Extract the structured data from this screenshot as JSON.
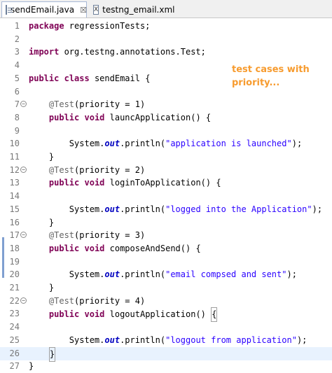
{
  "tabs": [
    {
      "label": "sendEmail.java",
      "icon": "java-file-icon",
      "active": true,
      "close": "☒"
    },
    {
      "label": "testng_email.xml",
      "icon": "xml-file-icon",
      "active": false,
      "icon_text": "X"
    }
  ],
  "note": "test cases with priority...",
  "colors": {
    "keyword": "#7f0055",
    "string": "#2a00ff",
    "annotation": "#646464",
    "note": "#f79b2e"
  },
  "lines": [
    {
      "n": "1",
      "fold": "",
      "tokens": [
        [
          "kw",
          "package"
        ],
        [
          "p",
          " regressionTests;"
        ]
      ]
    },
    {
      "n": "2",
      "fold": "",
      "tokens": []
    },
    {
      "n": "3",
      "fold": "",
      "tokens": [
        [
          "kw",
          "import"
        ],
        [
          "p",
          " org.testng.annotations.Test;"
        ]
      ]
    },
    {
      "n": "4",
      "fold": "",
      "tokens": []
    },
    {
      "n": "5",
      "fold": "",
      "tokens": [
        [
          "kw",
          "public"
        ],
        [
          "p",
          " "
        ],
        [
          "kw",
          "class"
        ],
        [
          "p",
          " sendEmail {"
        ]
      ]
    },
    {
      "n": "6",
      "fold": "",
      "tokens": []
    },
    {
      "n": "7",
      "fold": "⊖",
      "tokens": [
        [
          "p",
          "    "
        ],
        [
          "ann",
          "@Test"
        ],
        [
          "p",
          "(priority = 1)"
        ]
      ]
    },
    {
      "n": "8",
      "fold": "",
      "tokens": [
        [
          "p",
          "    "
        ],
        [
          "kw",
          "public"
        ],
        [
          "p",
          " "
        ],
        [
          "kw",
          "void"
        ],
        [
          "p",
          " launcApplication() {"
        ]
      ]
    },
    {
      "n": "9",
      "fold": "",
      "tokens": []
    },
    {
      "n": "10",
      "fold": "",
      "tokens": [
        [
          "p",
          "        System."
        ],
        [
          "stat",
          "out"
        ],
        [
          "p",
          ".println("
        ],
        [
          "str",
          "\"application is launched\""
        ],
        [
          "p",
          ");"
        ]
      ]
    },
    {
      "n": "11",
      "fold": "",
      "tokens": [
        [
          "p",
          "    }"
        ]
      ]
    },
    {
      "n": "12",
      "fold": "⊖",
      "tokens": [
        [
          "p",
          "    "
        ],
        [
          "ann",
          "@Test"
        ],
        [
          "p",
          "(priority = 2)"
        ]
      ]
    },
    {
      "n": "13",
      "fold": "",
      "tokens": [
        [
          "p",
          "    "
        ],
        [
          "kw",
          "public"
        ],
        [
          "p",
          " "
        ],
        [
          "kw",
          "void"
        ],
        [
          "p",
          " loginToApplication() {"
        ]
      ]
    },
    {
      "n": "14",
      "fold": "",
      "tokens": []
    },
    {
      "n": "15",
      "fold": "",
      "tokens": [
        [
          "p",
          "        System."
        ],
        [
          "stat",
          "out"
        ],
        [
          "p",
          ".println("
        ],
        [
          "str",
          "\"logged into the Application\""
        ],
        [
          "p",
          ");"
        ]
      ]
    },
    {
      "n": "16",
      "fold": "",
      "tokens": [
        [
          "p",
          "    }"
        ]
      ]
    },
    {
      "n": "17",
      "fold": "⊖",
      "tokens": [
        [
          "p",
          "    "
        ],
        [
          "ann",
          "@Test"
        ],
        [
          "p",
          "(priority = 3)"
        ]
      ]
    },
    {
      "n": "18",
      "fold": "",
      "tokens": [
        [
          "p",
          "    "
        ],
        [
          "kw",
          "public"
        ],
        [
          "p",
          " "
        ],
        [
          "kw",
          "void"
        ],
        [
          "p",
          " composeAndSend() {"
        ]
      ]
    },
    {
      "n": "19",
      "fold": "",
      "tokens": []
    },
    {
      "n": "20",
      "fold": "",
      "tokens": [
        [
          "p",
          "        System."
        ],
        [
          "stat",
          "out"
        ],
        [
          "p",
          ".println("
        ],
        [
          "str",
          "\"email compsed and sent\""
        ],
        [
          "p",
          ");"
        ]
      ]
    },
    {
      "n": "21",
      "fold": "",
      "tokens": [
        [
          "p",
          "    }"
        ]
      ]
    },
    {
      "n": "22",
      "fold": "⊖",
      "tokens": [
        [
          "p",
          "    "
        ],
        [
          "ann",
          "@Test"
        ],
        [
          "p",
          "(priority = 4)"
        ]
      ]
    },
    {
      "n": "23",
      "fold": "",
      "tokens": [
        [
          "p",
          "    "
        ],
        [
          "kw",
          "public"
        ],
        [
          "p",
          " "
        ],
        [
          "kw",
          "void"
        ],
        [
          "p",
          " logoutApplication() "
        ],
        [
          "box",
          "{"
        ]
      ]
    },
    {
      "n": "24",
      "fold": "",
      "tokens": []
    },
    {
      "n": "25",
      "fold": "",
      "tokens": [
        [
          "p",
          "        System."
        ],
        [
          "stat",
          "out"
        ],
        [
          "p",
          ".println("
        ],
        [
          "str",
          "\"loggout from application\""
        ],
        [
          "p",
          ");"
        ]
      ]
    },
    {
      "n": "26",
      "fold": "",
      "tokens": [
        [
          "p",
          "    "
        ],
        [
          "box",
          "}"
        ]
      ]
    },
    {
      "n": "27",
      "fold": "",
      "tokens": [
        [
          "p",
          "}"
        ]
      ]
    }
  ]
}
